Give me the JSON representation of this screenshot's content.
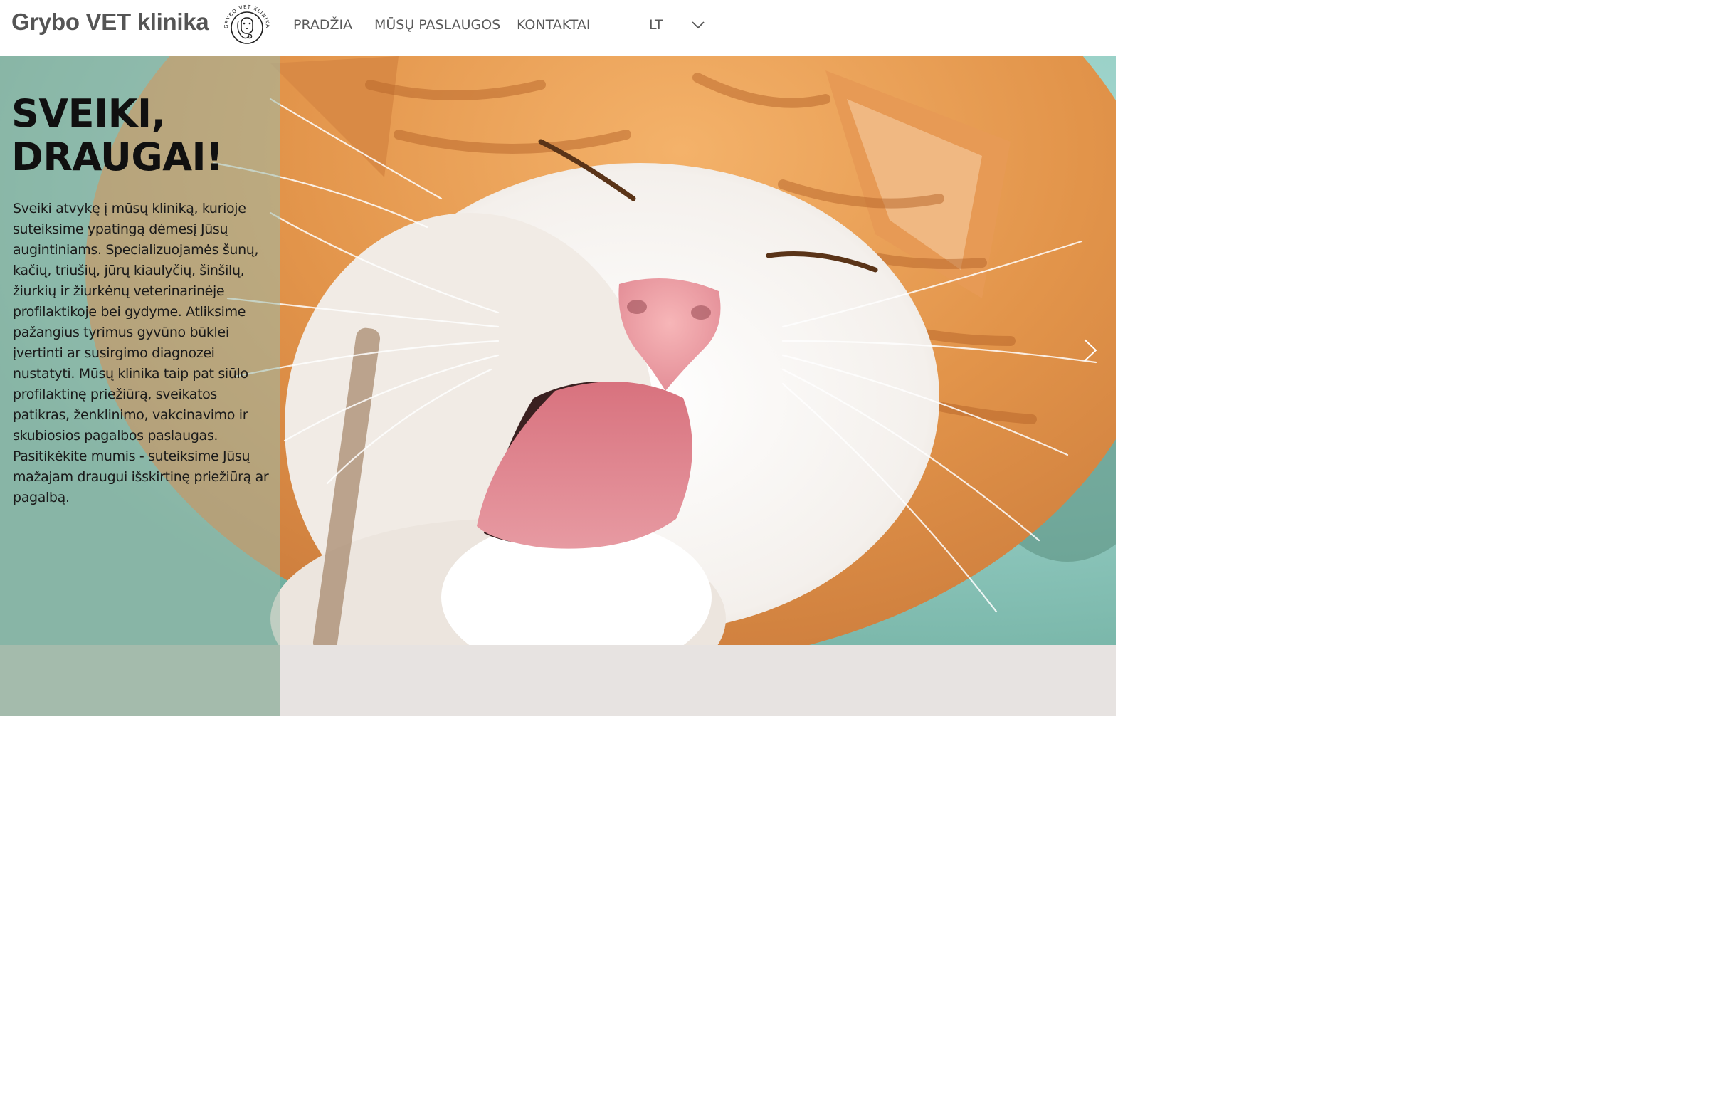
{
  "header": {
    "brand": "Grybo VET klinika",
    "logo_text": "GRYBO VET KLINIKA",
    "nav": [
      {
        "label": "PRADŽIA"
      },
      {
        "label": "MŪSŲ PASLAUGOS"
      },
      {
        "label": "KONTAKTAI"
      }
    ],
    "language": "LT"
  },
  "hero": {
    "title_line1": "SVEIKI,",
    "title_line2": "DRAUGAI!",
    "text": "Sveiki atvykę į mūsų kliniką, kurioje suteiksime ypatingą dėmesį Jūsų augintiniams. Specializuojamės šunų, kačių, triušių, jūrų kiaulyčių, šinšilų, žiurkių ir žiurkėnų veterinarinėje profilaktikoje bei gydyme. Atliksime pažangius tyrimus gyvūno būklei įvertinti ar susirgimo diagnozei nustatyti. Mūsų klinika taip pat siūlo profilaktinę priežiūrą, sveikatos patikras, ženklinimo, vakcinavimo ir skubiosios pagalbos paslaugas. Pasitikėkite mumis - suteiksime Jūsų mažajam draugui išskirtinę priežiūrą ar pagalbą."
  },
  "colors": {
    "overlay": "#9cbbac",
    "bottom_left": "#a4bbac",
    "bottom_right": "#e7e3e1",
    "nav_text": "#5a5a5a"
  },
  "icons": {
    "logo": "vet-clinic-logo-icon",
    "language_dropdown": "chevron-down-icon",
    "slider_next": "chevron-right-icon"
  }
}
